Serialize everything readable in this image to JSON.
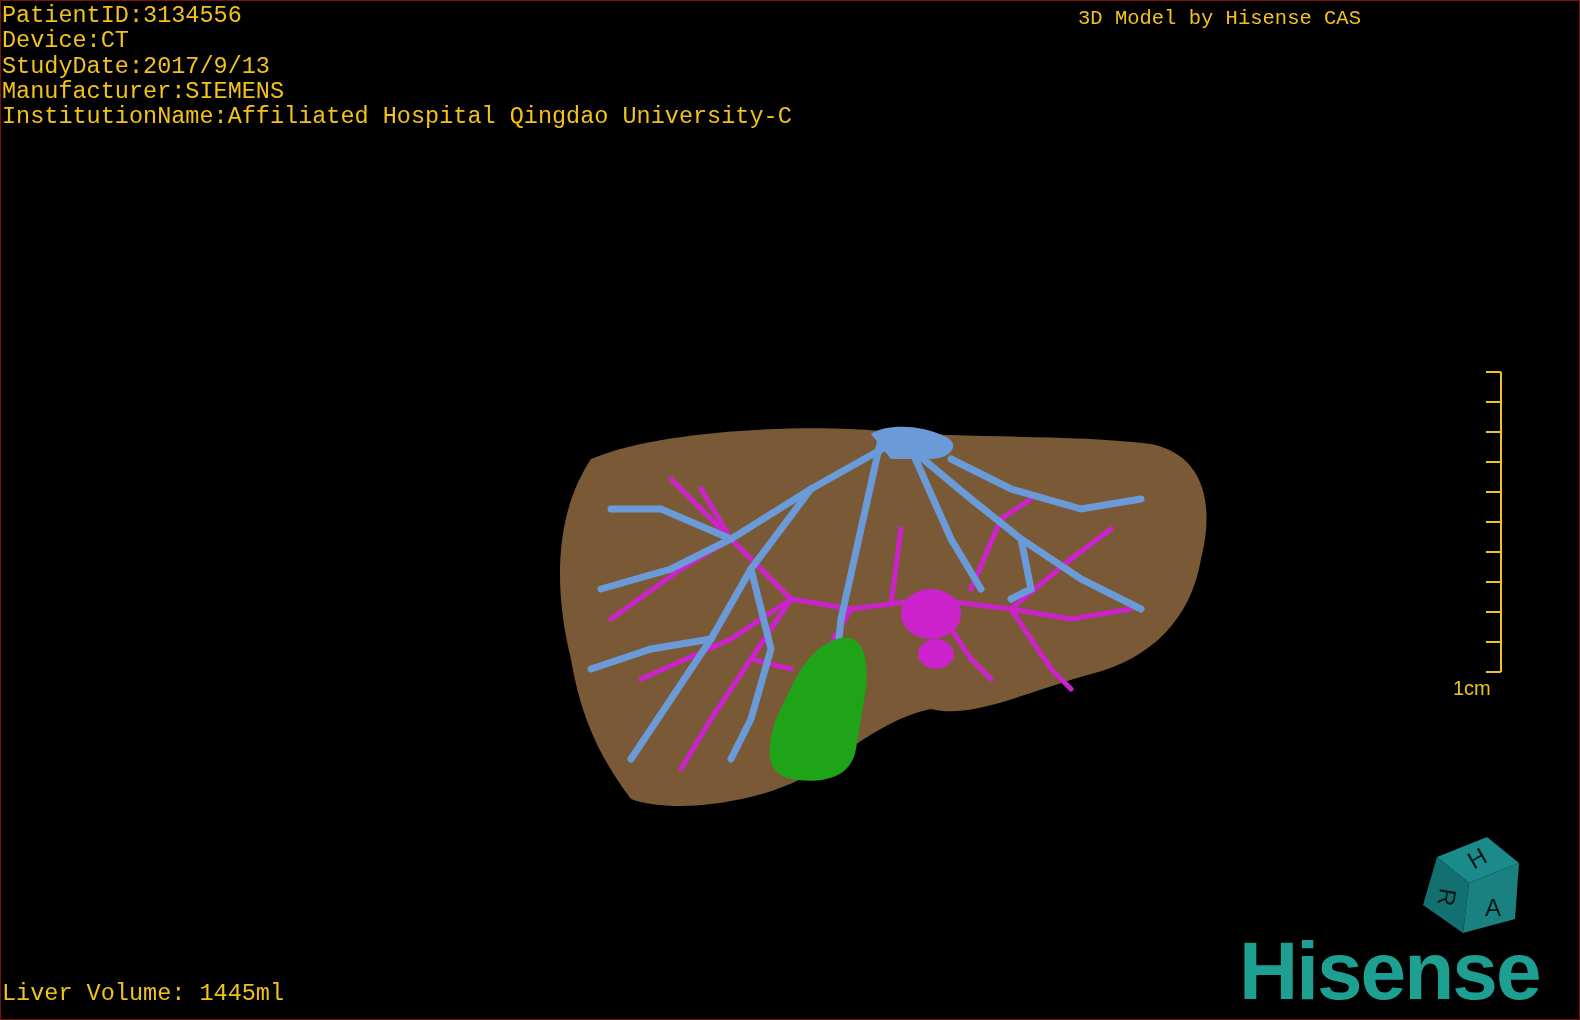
{
  "patient_info": [
    "PatientID:3134556",
    "Device:CT",
    "StudyDate:2017/9/13",
    "Manufacturer:SIEMENS",
    "InstitutionName:Affiliated Hospital Qingdao University-C"
  ],
  "header_right": "3D Model by Hisense CAS",
  "scale_bar": {
    "label": "1cm"
  },
  "orientation_cube": {
    "faces": [
      "H",
      "R",
      "A"
    ]
  },
  "logo": "Hisense",
  "liver_volume": "Liver Volume: 1445ml"
}
